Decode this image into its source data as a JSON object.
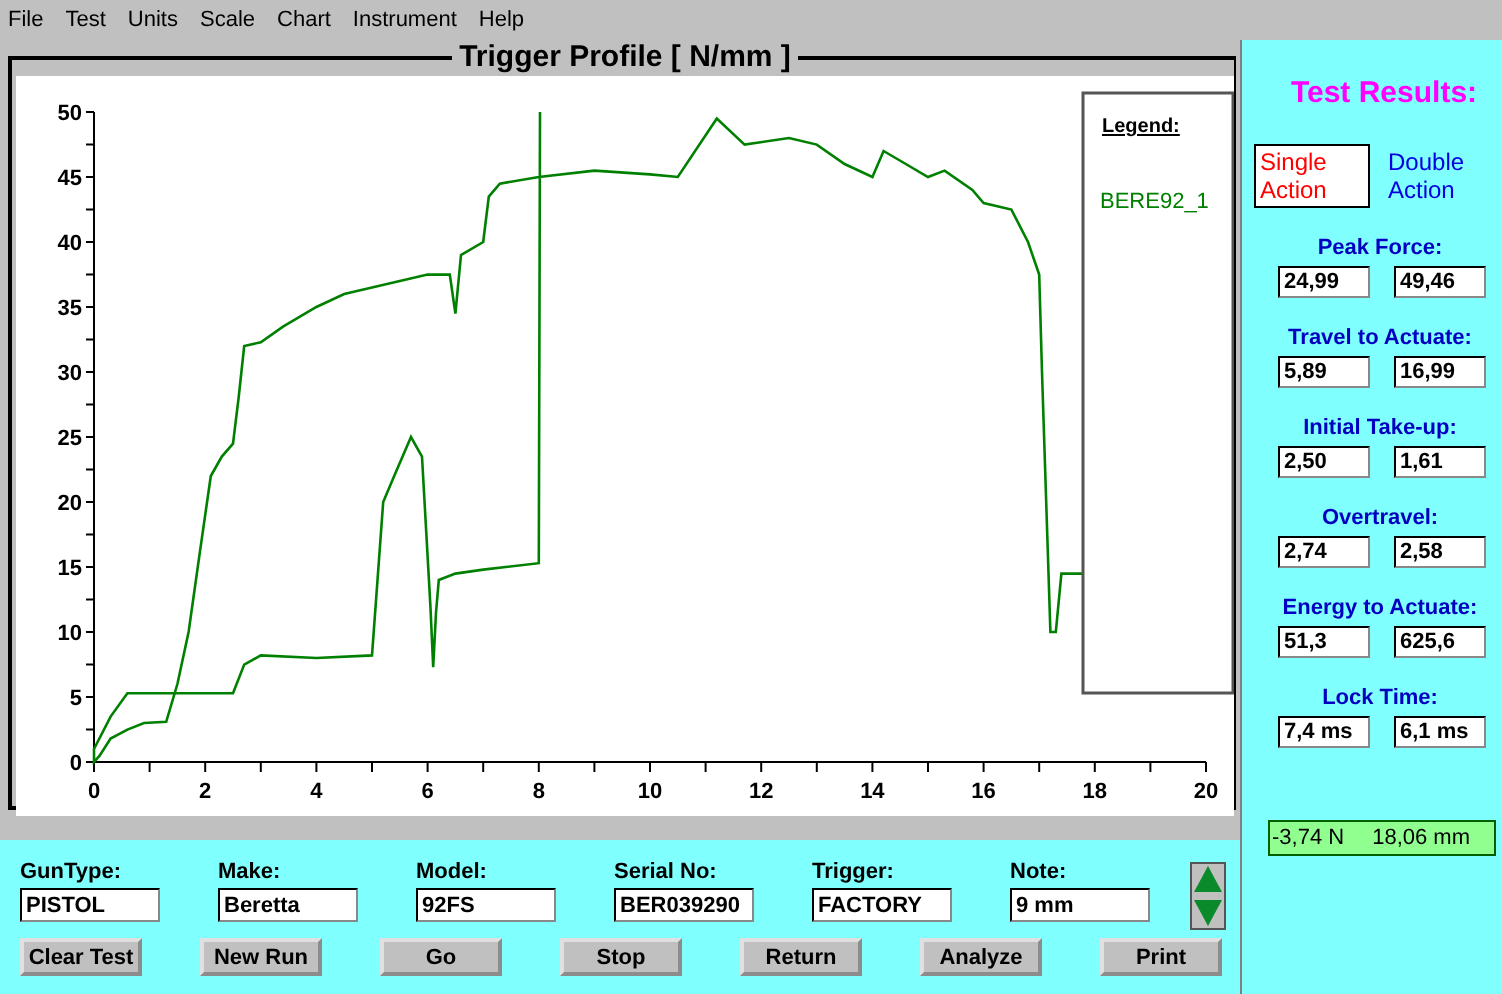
{
  "menu": [
    {
      "label": "File"
    },
    {
      "label": "Test"
    },
    {
      "label": "Units"
    },
    {
      "label": "Scale"
    },
    {
      "label": "Chart"
    },
    {
      "label": "Instrument"
    },
    {
      "label": "Help"
    }
  ],
  "chart": {
    "legend_title": "Legend:",
    "chart_data": {
      "type": "line",
      "title": "Trigger Profile [ N/mm ]",
      "xlim": [
        0,
        20
      ],
      "ylim": [
        0,
        50
      ],
      "xticks": [
        0,
        2,
        4,
        6,
        8,
        10,
        12,
        14,
        16,
        18,
        20
      ],
      "yticks": [
        0,
        5,
        10,
        15,
        20,
        25,
        30,
        35,
        40,
        45,
        50
      ],
      "x": [
        8.02,
        8,
        7,
        6.5,
        6.2,
        6.15,
        6.1,
        6.05,
        5.9,
        5.7,
        5.4,
        5.2,
        5,
        4,
        3,
        2.7,
        2.5,
        1,
        0.6,
        0.3,
        0,
        0,
        0.1,
        0.3,
        0.6,
        0.9,
        1.3,
        1.5,
        1.7,
        1.9,
        2.1,
        2.3,
        2.5,
        2.6,
        2.7,
        3,
        3.4,
        4,
        4.5,
        5,
        5.5,
        6,
        6.4,
        6.5,
        6.6,
        7,
        7.1,
        7.3,
        8,
        9,
        10,
        10.5,
        11.2,
        11.7,
        12.5,
        13,
        13.5,
        14,
        14.2,
        14.6,
        15,
        15.3,
        15.8,
        16,
        16.5,
        16.8,
        17,
        17.05,
        17.2,
        17.3,
        17.4,
        17.6,
        17.8
      ],
      "series": [
        {
          "name": "BERE92_1",
          "color": "#008000",
          "values": [
            50,
            15.3,
            14.8,
            14.5,
            14,
            11.5,
            7.3,
            12,
            23.5,
            25,
            22,
            20,
            8.2,
            8,
            8.2,
            7.5,
            5.3,
            5.3,
            5.3,
            3.5,
            1,
            0,
            0.5,
            1.8,
            2.5,
            3,
            3.1,
            6,
            10,
            16,
            22,
            23.5,
            24.5,
            28,
            32,
            32.3,
            33.5,
            35,
            36,
            36.5,
            37,
            37.5,
            37.5,
            34.5,
            39,
            40,
            43.5,
            44.5,
            45,
            45.5,
            45.2,
            45,
            49.5,
            47.5,
            48,
            47.5,
            46,
            45,
            47,
            46,
            45,
            45.5,
            44,
            43,
            42.5,
            40,
            37.5,
            30,
            10,
            10,
            14.5,
            14.5,
            14.5
          ]
        }
      ]
    }
  },
  "results": {
    "title": "Test Results:",
    "modes": [
      {
        "label": "Single Action",
        "selected": true
      },
      {
        "label": "Double Action",
        "selected": false
      }
    ],
    "items": [
      {
        "label": "Peak Force:",
        "values": [
          "24,99",
          "49,46"
        ]
      },
      {
        "label": "Travel to Actuate:",
        "values": [
          "5,89",
          "16,99"
        ]
      },
      {
        "label": "Initial Take-up:",
        "values": [
          "2,50",
          "1,61"
        ]
      },
      {
        "label": "Overtravel:",
        "values": [
          "2,74",
          "2,58"
        ]
      },
      {
        "label": "Energy to Actuate:",
        "values": [
          "51,3",
          "625,6"
        ]
      },
      {
        "label": "Lock Time:",
        "values": [
          "7,4 ms",
          "6,1 ms"
        ]
      }
    ]
  },
  "fields": [
    {
      "label": "GunType:",
      "value": "PISTOL"
    },
    {
      "label": "Make:",
      "value": "Beretta"
    },
    {
      "label": "Model:",
      "value": "92FS"
    },
    {
      "label": "Serial No:",
      "value": "BER039290"
    },
    {
      "label": "Trigger:",
      "value": "FACTORY"
    },
    {
      "label": "Note:",
      "value": "9 mm"
    }
  ],
  "buttons": [
    "Clear Test",
    "New Run",
    "Go",
    "Stop",
    "Return",
    "Analyze",
    "Print"
  ],
  "status": {
    "force": "-3,74 N",
    "travel": "18,06 mm"
  }
}
